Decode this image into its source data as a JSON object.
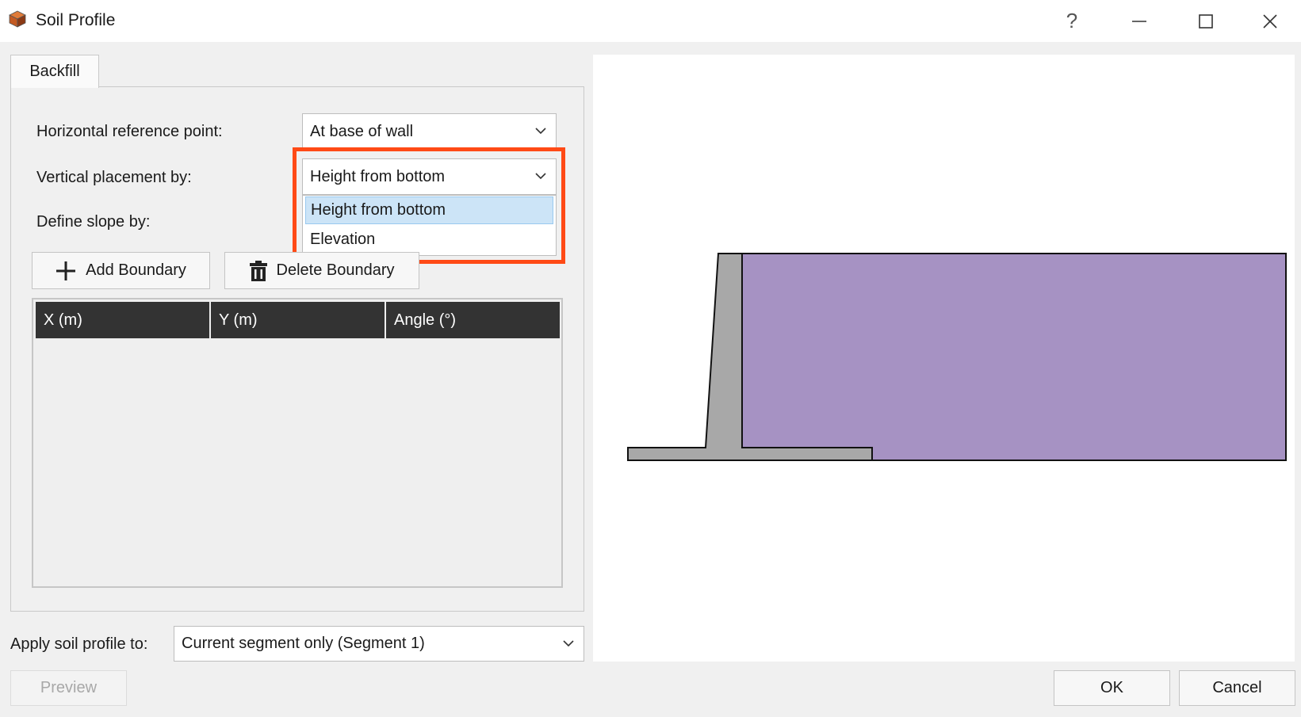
{
  "window": {
    "title": "Soil Profile",
    "icons": [
      "app-icon",
      "help-icon",
      "minimize-icon",
      "maximize-icon",
      "close-icon"
    ],
    "help_label": "?"
  },
  "tabs": [
    {
      "label": "Backfill",
      "selected": true
    }
  ],
  "form": {
    "horizontal_label": "Horizontal reference point:",
    "horizontal_value": "At base of wall",
    "vertical_label": "Vertical placement by:",
    "vertical_value": "Height from bottom",
    "vertical_options": [
      "Height from bottom",
      "Elevation"
    ],
    "vertical_highlighted_option": "Height from bottom",
    "slope_label": "Define slope by:"
  },
  "toolbar": {
    "add_boundary_label": "Add Boundary",
    "delete_boundary_label": "Delete Boundary"
  },
  "table": {
    "columns": [
      "X (m)",
      "Y (m)",
      "Angle (°)"
    ],
    "rows": []
  },
  "apply": {
    "label": "Apply soil profile to:",
    "value": "Current segment only (Segment 1)"
  },
  "buttons": {
    "preview": "Preview",
    "ok": "OK",
    "cancel": "Cancel"
  },
  "colors": {
    "highlight": "#ff4a16",
    "soil": "#a692c3",
    "wall": "#a8a8a8",
    "header": "#333333",
    "selected_option": "#cce4f7"
  }
}
